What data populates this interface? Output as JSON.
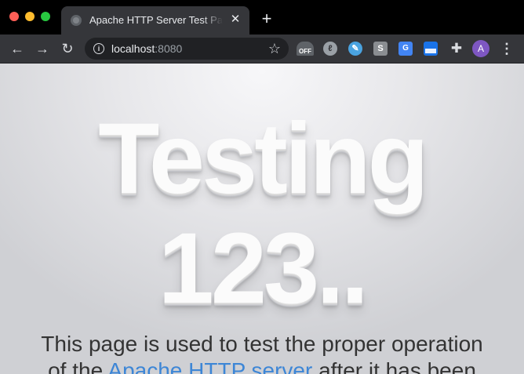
{
  "browser": {
    "tab": {
      "title": "Apache HTTP Server Test Page",
      "close_label": "✕"
    },
    "new_tab_label": "+",
    "url": {
      "host": "localhost",
      "port": ":8080"
    },
    "extensions": {
      "off_badge": "OFF",
      "s_label": "S",
      "g_label": "G",
      "avatar_letter": "A"
    }
  },
  "page": {
    "hero_line1": "Testing",
    "hero_line2": "123..",
    "intro_line1": "This page is used to test the proper operation",
    "intro_line2_start": "of the ",
    "intro_link": "Apache HTTP server",
    "intro_line2_end": " after it has been"
  },
  "colors": {
    "link": "#3d86d6",
    "hero_text": "#fbfbfb",
    "body_text": "#333333",
    "avatar": "#7e57c2"
  }
}
